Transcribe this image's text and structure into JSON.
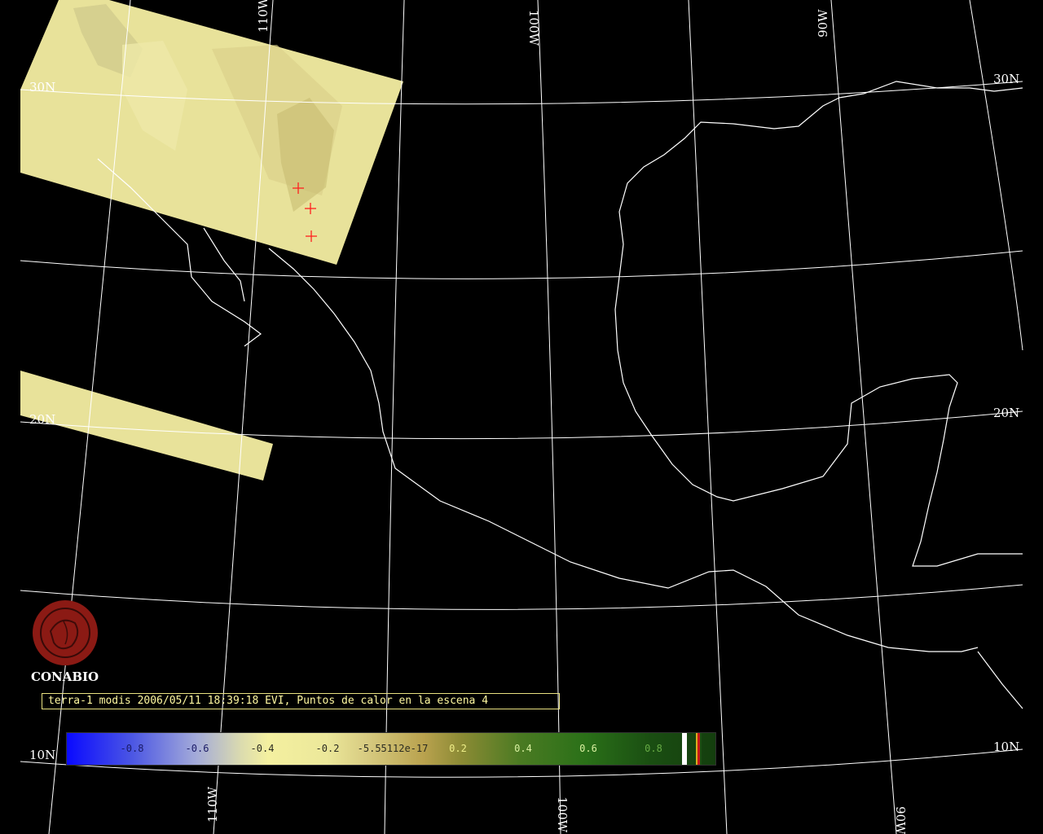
{
  "map": {
    "longitude_labels": [
      "110W",
      "100W",
      "90W"
    ],
    "latitude_labels": [
      "30N",
      "20N",
      "10N"
    ],
    "hotspots_count": 3,
    "hotspot_color": "#ff2020",
    "scene_color": "#e8e29a",
    "coastline_color": "#ffffff",
    "grid_color": "#ffffff"
  },
  "logo": {
    "name": "CONABIO",
    "emblem_color": "#8b1a14"
  },
  "caption": {
    "text": "terra-1 modis 2006/05/11 18:39:18 EVI, Puntos de calor en la escena 4"
  },
  "colorbar": {
    "ticks": [
      {
        "label": "-0.8",
        "color": "#1a1a66"
      },
      {
        "label": "-0.6",
        "color": "#1a1a66"
      },
      {
        "label": "-0.4",
        "color": "#2b2b20"
      },
      {
        "label": "-0.2",
        "color": "#2b2b20"
      },
      {
        "label": "-5.55112e-17",
        "color": "#2b2b20"
      },
      {
        "label": "0.2",
        "color": "#eeee88"
      },
      {
        "label": "0.4",
        "color": "#d8f0a0"
      },
      {
        "label": "0.6",
        "color": "#d8f0a0"
      },
      {
        "label": "0.8",
        "color": "#66aa44"
      }
    ],
    "flag_colors": [
      "#ffffff",
      "#d6ae20",
      "#c81818",
      "#1a4e12"
    ]
  }
}
